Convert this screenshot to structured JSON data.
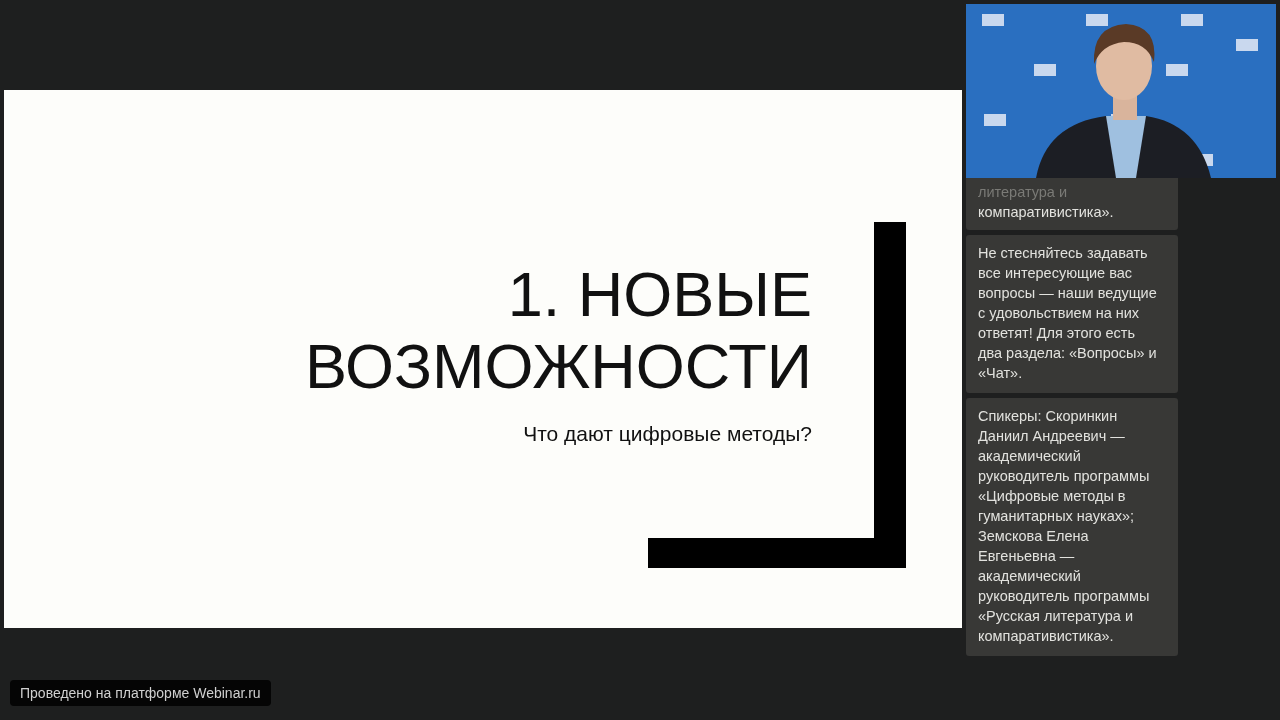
{
  "slide": {
    "title_lines": [
      "1. НОВЫЕ",
      "ВОЗМОЖНОСТИ"
    ],
    "subtitle": "Что дают цифровые методы?"
  },
  "chat": {
    "messages": [
      {
        "lines": [
          "литература и",
          "компаративистика»."
        ],
        "partial": true
      },
      {
        "text": "Не стесняйтесь задавать все интересующие вас вопросы — наши ведущие с удовольствием на них ответят! Для этого есть два раздела: «Вопросы» и «Чат».",
        "partial": false
      },
      {
        "text": "Спикеры: Скоринкин Даниил Андреевич — академический руководитель программы «Цифровые методы в гуманитарных науках»; Земскова Елена Евгеньевна — академический руководитель программы «Русская литература и компаративистика».",
        "partial": false
      }
    ]
  },
  "footer": {
    "badge": "Проведено на платформе Webinar.ru"
  }
}
